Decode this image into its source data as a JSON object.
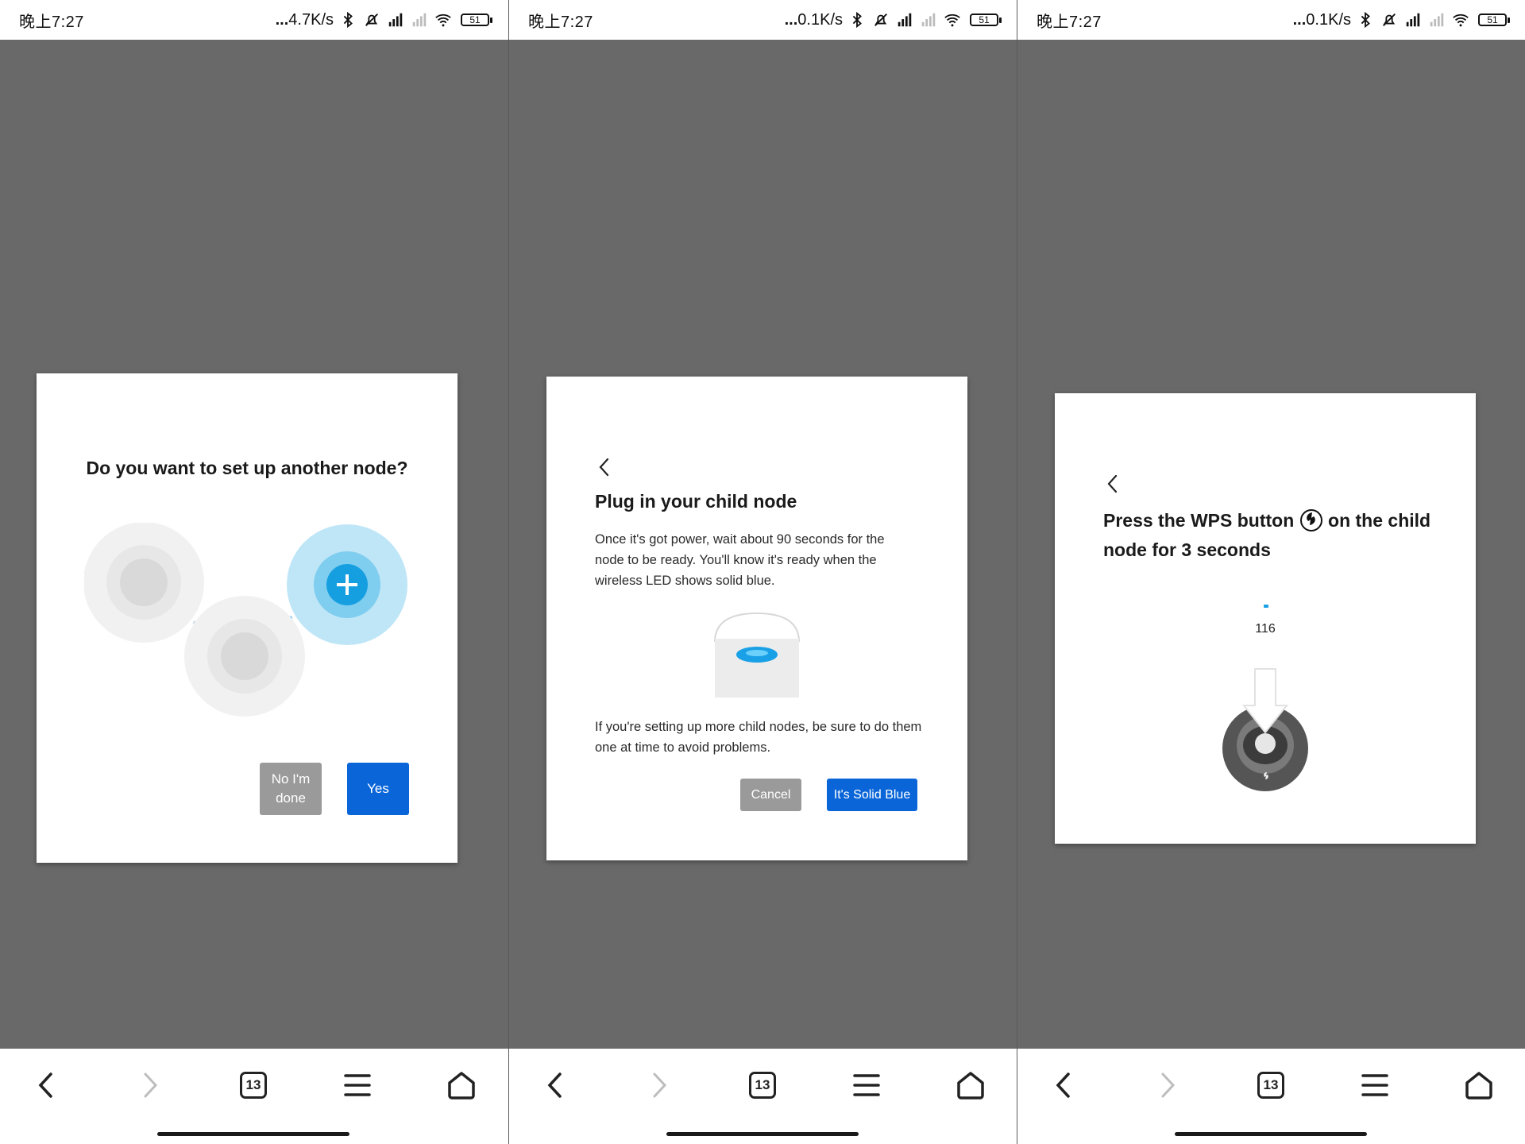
{
  "status_bar": [
    {
      "time": "晚上7:27",
      "net_speed": "4.7K/s",
      "battery": "51"
    },
    {
      "time": "晚上7:27",
      "net_speed": "0.1K/s",
      "battery": "51"
    },
    {
      "time": "晚上7:27",
      "net_speed": "0.1K/s",
      "battery": "51"
    }
  ],
  "screen1": {
    "title": "Do you want to set up another node?",
    "no_label": "No I'm done",
    "yes_label": "Yes"
  },
  "screen2": {
    "title": "Plug in your child node",
    "body": "Once it's got power, wait about 90 seconds for the node to be ready. You'll know it's ready when the wireless LED shows solid blue.",
    "body2": "If you're setting up more child nodes, be sure to do them one at time to avoid problems.",
    "cancel_label": "Cancel",
    "confirm_label": "It's Solid Blue"
  },
  "screen3": {
    "title_part1": "Press the WPS button",
    "title_part2": "on the child node for 3 seconds",
    "counter": "116"
  },
  "nav": {
    "tab_count": "13"
  },
  "colors": {
    "accent_blue": "#0a66d8",
    "button_grey": "#9a9a9a",
    "backdrop": "#696969",
    "led_blue": "#1aa0e6"
  },
  "icons": [
    "back-chevron-icon",
    "forward-chevron-icon",
    "tabs-icon",
    "menu-icon",
    "home-icon",
    "wps-icon",
    "plus-icon",
    "bluetooth-icon",
    "mute-icon",
    "signal-icon",
    "wifi-icon",
    "battery-icon"
  ]
}
